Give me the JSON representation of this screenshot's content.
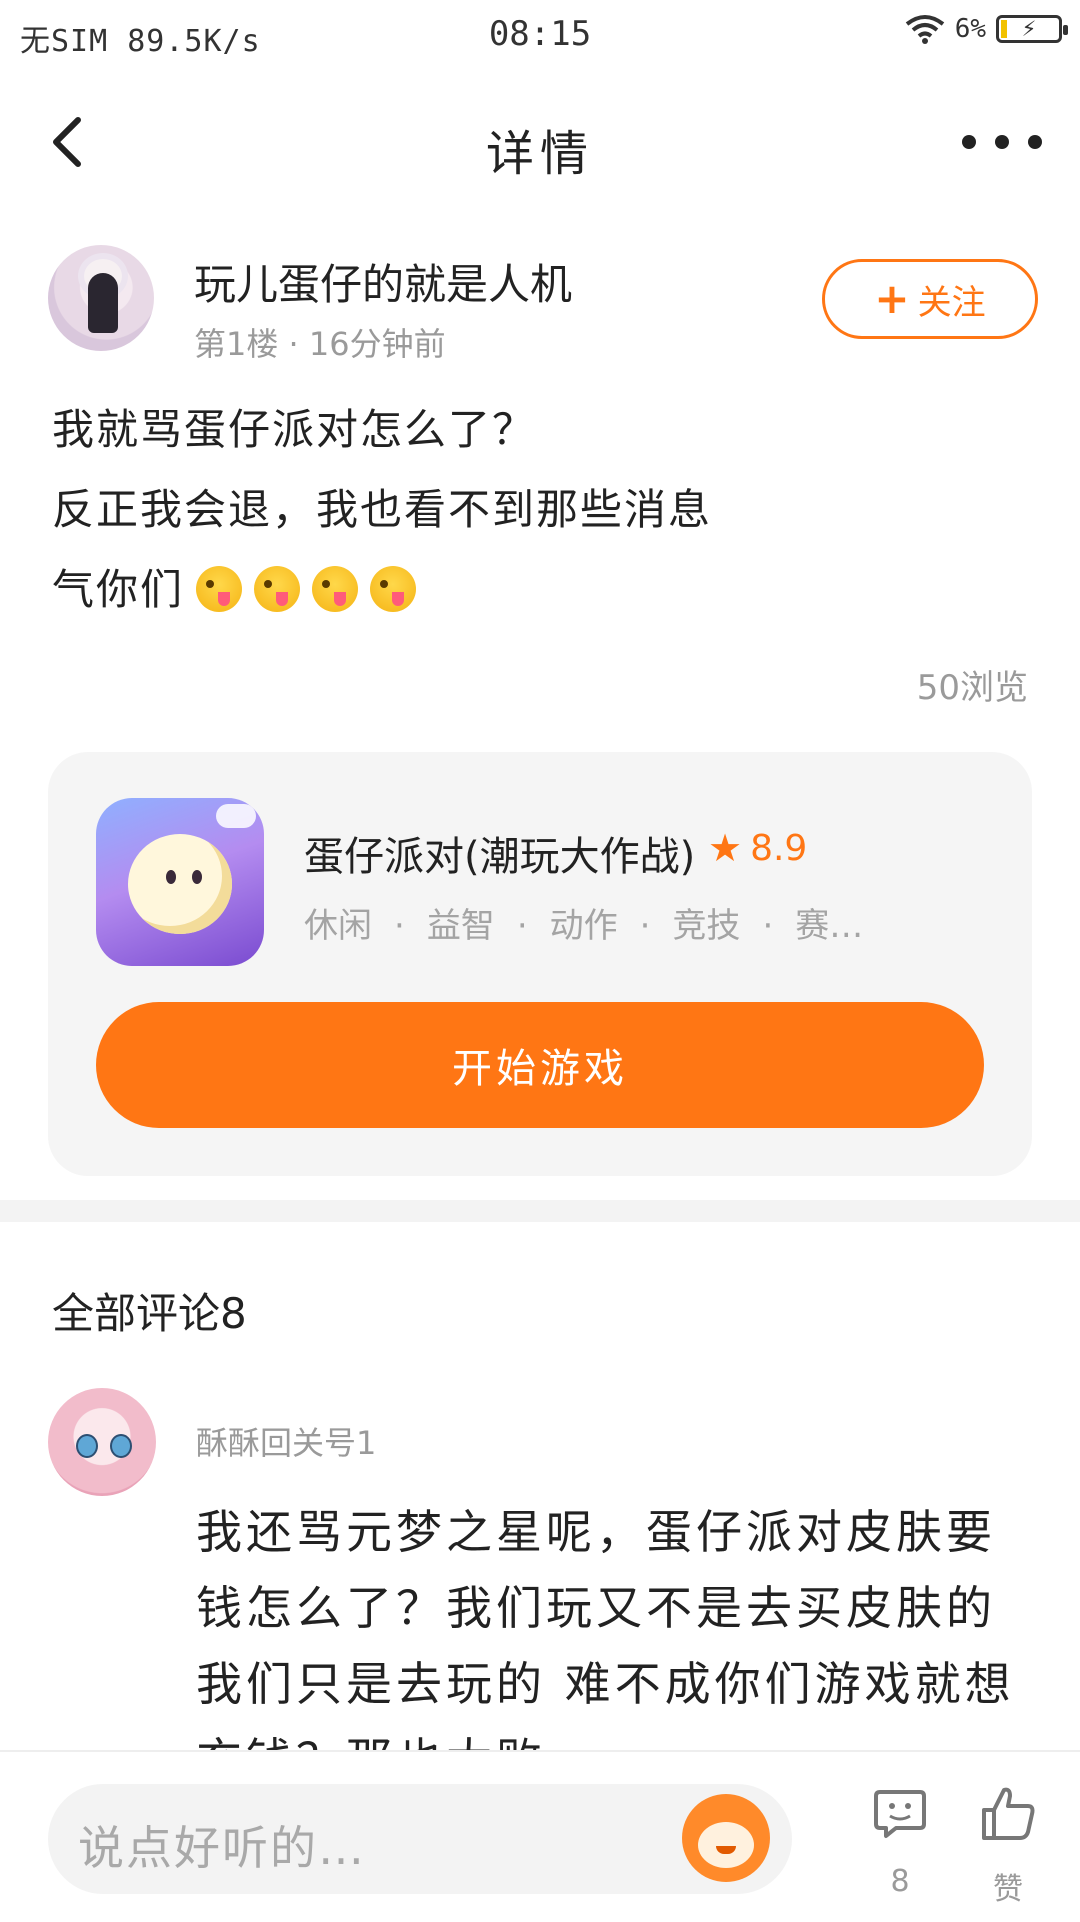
{
  "status_bar": {
    "left": "无SIM 89.5K/s",
    "time": "08:15",
    "battery": "6%"
  },
  "nav": {
    "title": "详情"
  },
  "post": {
    "author": "玩儿蛋仔的就是人机",
    "meta": "第1楼 · 16分钟前",
    "follow_label": "关注",
    "lines": [
      "我就骂蛋仔派对怎么了？",
      "反正我会退，我也看不到那些消息",
      "气你们"
    ],
    "emoji_count": 4,
    "views": "50浏览"
  },
  "game": {
    "title": "蛋仔派对(潮玩大作战)",
    "rating": "8.9",
    "tags": [
      "休闲",
      "益智",
      "动作",
      "竞技",
      "赛…"
    ],
    "play_label": "开始游戏",
    "accent": "#ff7614"
  },
  "comments": {
    "header": "全部评论8",
    "items": [
      {
        "name": "酥酥回关号1",
        "text": "我还骂元梦之星呢，蛋仔派对皮肤要钱怎么了？我们玩又不是去买皮肤的 我们只是去玩的 难不成你们游戏就想充钱？那也太败"
      }
    ]
  },
  "bottom_bar": {
    "placeholder": "说点好听的…",
    "comment_count": "8",
    "like_label": "赞"
  }
}
